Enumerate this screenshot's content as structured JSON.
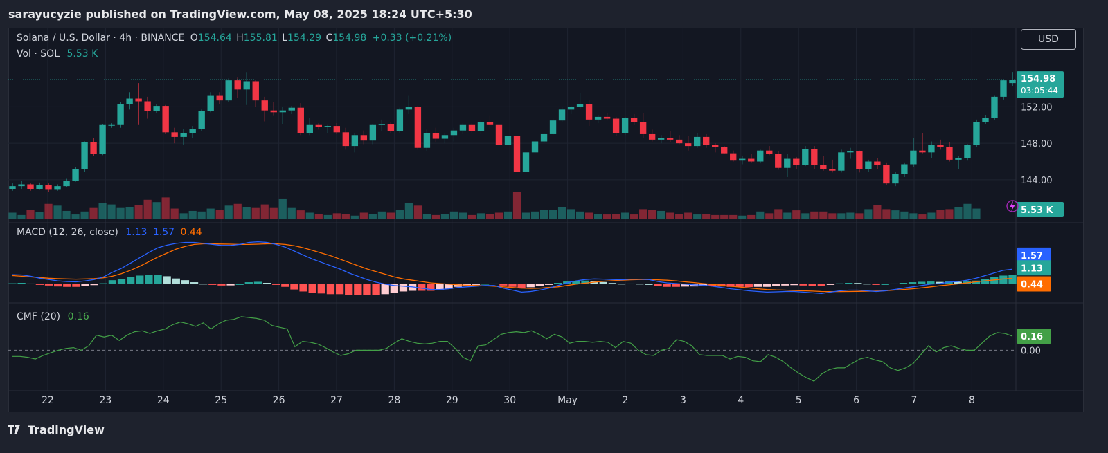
{
  "header": {
    "publisher": "sarayucyzie published on TradingView.com, May 08, 2025 18:24 UTC+5:30"
  },
  "legend": {
    "symbol": "Solana / U.S. Dollar · 4h · BINANCE",
    "o_label": "O",
    "o": "154.64",
    "h_label": "H",
    "h": "155.81",
    "l_label": "L",
    "l": "154.29",
    "c_label": "C",
    "c": "154.98",
    "change": "+0.33 (+0.21%)",
    "vol_label": "Vol · SOL",
    "vol": "5.53 K",
    "macd_label": "MACD (12, 26, close)",
    "macd": "1.13",
    "signal": "1.57",
    "hist": "0.44",
    "cmf_label": "CMF (20)",
    "cmf": "0.16"
  },
  "currency_button": "USD",
  "price_axis": {
    "ticks": [
      "152.00",
      "148.00",
      "144.00"
    ],
    "last_price": "154.98",
    "countdown": "03:05:44",
    "vol_badge": "5.53 K",
    "macd_badges": [
      "1.57",
      "1.13",
      "0.44"
    ],
    "cmf_badges": [
      "0.16",
      "0.00"
    ]
  },
  "colors": {
    "up": "#26a69a",
    "down": "#f23645",
    "macd": "#2962ff",
    "signal": "#ff6d00",
    "cmf": "#43a047",
    "hist_up_strong": "#26a69a",
    "hist_up_weak": "#b2dfdb",
    "hist_down_strong": "#ff5252",
    "hist_down_weak": "#ffcdd2"
  },
  "footer": {
    "brand": "TradingView"
  },
  "chart_data": {
    "type": "candlestick",
    "symbol": "SOLUSD",
    "interval": "4h",
    "exchange": "BINANCE",
    "x_tick_labels": [
      "22",
      "23",
      "24",
      "25",
      "26",
      "27",
      "28",
      "29",
      "30",
      "May",
      "2",
      "3",
      "4",
      "5",
      "6",
      "7",
      "8"
    ],
    "price_ylim": [
      140.2,
      158.4
    ],
    "ohlc": [
      [
        143.0,
        143.6,
        142.8,
        143.3
      ],
      [
        143.3,
        143.9,
        143.0,
        143.5
      ],
      [
        143.5,
        143.6,
        142.8,
        143.0
      ],
      [
        143.0,
        143.7,
        142.9,
        143.4
      ],
      [
        143.4,
        143.6,
        142.7,
        142.9
      ],
      [
        142.9,
        143.5,
        142.8,
        143.3
      ],
      [
        143.3,
        144.1,
        143.2,
        143.9
      ],
      [
        143.9,
        145.4,
        143.8,
        145.2
      ],
      [
        145.2,
        148.2,
        144.9,
        148.1
      ],
      [
        148.1,
        148.6,
        146.6,
        146.8
      ],
      [
        146.8,
        150.1,
        146.7,
        150.0
      ],
      [
        150.0,
        150.2,
        149.7,
        150.0
      ],
      [
        150.0,
        152.5,
        149.7,
        152.3
      ],
      [
        152.3,
        153.6,
        151.7,
        152.9
      ],
      [
        152.9,
        154.6,
        150.0,
        152.6
      ],
      [
        152.6,
        153.1,
        150.7,
        151.5
      ],
      [
        151.5,
        152.3,
        151.3,
        152.1
      ],
      [
        152.1,
        152.2,
        149.0,
        149.2
      ],
      [
        149.2,
        149.7,
        148.0,
        148.7
      ],
      [
        148.7,
        149.6,
        147.8,
        149.1
      ],
      [
        149.1,
        149.9,
        148.6,
        149.6
      ],
      [
        149.6,
        151.7,
        149.3,
        151.5
      ],
      [
        151.5,
        153.6,
        151.4,
        153.2
      ],
      [
        153.2,
        153.6,
        152.3,
        152.7
      ],
      [
        152.7,
        155.1,
        152.5,
        154.9
      ],
      [
        154.9,
        155.2,
        153.0,
        153.9
      ],
      [
        153.9,
        155.8,
        152.2,
        154.8
      ],
      [
        154.8,
        154.9,
        152.0,
        152.7
      ],
      [
        152.7,
        153.1,
        150.4,
        151.6
      ],
      [
        151.6,
        152.5,
        151.0,
        151.4
      ],
      [
        151.4,
        152.0,
        150.1,
        151.6
      ],
      [
        151.6,
        152.1,
        151.2,
        151.9
      ],
      [
        151.9,
        152.4,
        148.9,
        149.1
      ],
      [
        149.1,
        150.8,
        148.9,
        150.0
      ],
      [
        150.0,
        150.2,
        149.5,
        149.8
      ],
      [
        149.8,
        150.0,
        149.1,
        149.9
      ],
      [
        149.9,
        150.2,
        149.0,
        149.2
      ],
      [
        149.2,
        149.7,
        147.3,
        147.7
      ],
      [
        147.7,
        149.1,
        147.0,
        148.9
      ],
      [
        148.9,
        149.4,
        147.9,
        148.3
      ],
      [
        148.3,
        150.1,
        147.9,
        150.0
      ],
      [
        150.0,
        150.6,
        149.3,
        150.1
      ],
      [
        150.1,
        150.3,
        149.1,
        149.3
      ],
      [
        149.3,
        151.9,
        149.1,
        151.7
      ],
      [
        151.7,
        153.2,
        151.2,
        152.0
      ],
      [
        152.0,
        152.1,
        147.3,
        147.5
      ],
      [
        147.5,
        149.5,
        147.1,
        149.1
      ],
      [
        149.1,
        149.7,
        148.1,
        148.5
      ],
      [
        148.5,
        149.1,
        148.0,
        148.9
      ],
      [
        148.9,
        149.7,
        148.2,
        149.4
      ],
      [
        149.4,
        150.2,
        149.0,
        150.0
      ],
      [
        150.0,
        150.2,
        149.1,
        149.3
      ],
      [
        149.3,
        150.5,
        149.0,
        150.3
      ],
      [
        150.3,
        151.0,
        149.6,
        150.0
      ],
      [
        150.0,
        150.2,
        147.6,
        147.8
      ],
      [
        147.8,
        149.0,
        147.4,
        148.8
      ],
      [
        148.8,
        148.9,
        144.0,
        144.9
      ],
      [
        144.9,
        147.1,
        144.8,
        147.0
      ],
      [
        147.0,
        148.3,
        146.9,
        148.2
      ],
      [
        148.2,
        149.1,
        148.0,
        149.0
      ],
      [
        149.0,
        150.7,
        148.9,
        150.5
      ],
      [
        150.5,
        152.0,
        150.3,
        151.7
      ],
      [
        151.7,
        152.1,
        151.2,
        152.0
      ],
      [
        152.0,
        153.5,
        151.8,
        152.3
      ],
      [
        152.3,
        152.7,
        149.9,
        150.6
      ],
      [
        150.6,
        151.1,
        150.2,
        150.9
      ],
      [
        150.9,
        151.3,
        150.5,
        150.7
      ],
      [
        150.7,
        150.9,
        148.8,
        149.1
      ],
      [
        149.1,
        150.9,
        148.9,
        150.8
      ],
      [
        150.8,
        151.2,
        150.0,
        150.3
      ],
      [
        150.3,
        151.3,
        148.6,
        149.0
      ],
      [
        149.0,
        149.5,
        148.2,
        148.4
      ],
      [
        148.4,
        148.9,
        148.0,
        148.6
      ],
      [
        148.6,
        149.3,
        148.1,
        148.4
      ],
      [
        148.4,
        148.9,
        147.9,
        148.0
      ],
      [
        148.0,
        148.8,
        147.2,
        147.7
      ],
      [
        147.7,
        149.1,
        147.5,
        148.7
      ],
      [
        148.7,
        149.0,
        147.5,
        147.8
      ],
      [
        147.8,
        148.0,
        147.0,
        147.6
      ],
      [
        147.6,
        147.7,
        146.8,
        146.9
      ],
      [
        146.9,
        147.2,
        146.0,
        146.1
      ],
      [
        146.1,
        146.6,
        145.7,
        146.3
      ],
      [
        146.3,
        146.8,
        145.9,
        146.0
      ],
      [
        146.0,
        147.3,
        145.8,
        147.2
      ],
      [
        147.2,
        147.7,
        146.7,
        146.8
      ],
      [
        146.8,
        147.1,
        145.1,
        145.3
      ],
      [
        145.3,
        146.8,
        144.3,
        146.3
      ],
      [
        146.3,
        146.5,
        145.2,
        145.6
      ],
      [
        145.6,
        147.7,
        145.5,
        147.4
      ],
      [
        147.4,
        147.7,
        145.2,
        145.6
      ],
      [
        145.6,
        146.6,
        145.0,
        145.2
      ],
      [
        145.2,
        146.2,
        144.8,
        145.0
      ],
      [
        145.0,
        147.3,
        144.8,
        147.0
      ],
      [
        147.0,
        147.5,
        146.3,
        147.1
      ],
      [
        147.1,
        147.2,
        144.8,
        145.2
      ],
      [
        145.2,
        146.2,
        144.9,
        146.0
      ],
      [
        146.0,
        146.4,
        145.2,
        145.6
      ],
      [
        145.6,
        145.9,
        143.4,
        143.6
      ],
      [
        143.6,
        144.9,
        143.3,
        144.6
      ],
      [
        144.6,
        145.9,
        144.3,
        145.7
      ],
      [
        145.7,
        148.6,
        145.4,
        147.2
      ],
      [
        147.2,
        149.1,
        146.9,
        147.0
      ],
      [
        147.0,
        148.2,
        146.4,
        147.8
      ],
      [
        147.8,
        148.4,
        147.3,
        147.6
      ],
      [
        147.6,
        148.1,
        146.0,
        146.2
      ],
      [
        146.2,
        146.6,
        145.2,
        146.4
      ],
      [
        146.4,
        147.9,
        146.1,
        147.8
      ],
      [
        147.8,
        150.6,
        147.6,
        150.3
      ],
      [
        150.3,
        151.1,
        150.1,
        150.8
      ],
      [
        150.8,
        153.2,
        150.6,
        153.1
      ],
      [
        153.1,
        155.0,
        152.8,
        154.9
      ],
      [
        154.6,
        155.81,
        154.29,
        154.98
      ]
    ],
    "volume_k": [
      1.0,
      0.6,
      1.5,
      1.1,
      2.5,
      2.2,
      1.3,
      0.7,
      1.2,
      1.8,
      2.6,
      2.4,
      1.8,
      2.0,
      2.3,
      3.2,
      2.8,
      3.6,
      1.7,
      0.9,
      1.3,
      1.2,
      1.7,
      1.5,
      2.2,
      2.5,
      2.0,
      1.8,
      2.4,
      1.8,
      3.3,
      1.8,
      1.4,
      1.0,
      0.8,
      0.6,
      0.9,
      0.8,
      0.5,
      1.0,
      0.8,
      1.2,
      1.0,
      1.5,
      2.7,
      2.2,
      0.8,
      0.6,
      0.8,
      1.2,
      1.0,
      0.6,
      0.9,
      0.8,
      1.0,
      1.2,
      4.5,
      1.0,
      1.2,
      1.5,
      1.5,
      1.9,
      1.6,
      1.2,
      1.0,
      0.8,
      0.7,
      0.8,
      1.0,
      0.7,
      1.6,
      1.5,
      1.3,
      1.0,
      0.8,
      1.0,
      0.7,
      0.8,
      0.6,
      0.6,
      0.6,
      0.5,
      0.6,
      1.2,
      0.9,
      1.6,
      1.0,
      1.4,
      0.9,
      1.2,
      1.2,
      0.9,
      0.9,
      1.0,
      0.9,
      1.6,
      2.3,
      1.6,
      1.4,
      1.2,
      0.9,
      0.7,
      1.0,
      1.5,
      1.6,
      2.0,
      2.5,
      1.7
    ],
    "macd": [
      0.72,
      0.7,
      0.6,
      0.45,
      0.35,
      0.25,
      0.2,
      0.18,
      0.25,
      0.35,
      0.55,
      0.9,
      1.2,
      1.6,
      2.0,
      2.4,
      2.75,
      2.95,
      3.08,
      3.15,
      3.15,
      3.08,
      3.0,
      2.93,
      2.93,
      3.0,
      3.15,
      3.2,
      3.15,
      3.0,
      2.8,
      2.5,
      2.2,
      1.9,
      1.65,
      1.4,
      1.15,
      0.85,
      0.6,
      0.35,
      0.15,
      0.0,
      -0.1,
      -0.15,
      -0.2,
      -0.3,
      -0.4,
      -0.4,
      -0.35,
      -0.25,
      -0.2,
      -0.15,
      -0.1,
      -0.1,
      -0.3,
      -0.45,
      -0.6,
      -0.55,
      -0.45,
      -0.3,
      -0.1,
      0.1,
      0.25,
      0.35,
      0.4,
      0.38,
      0.35,
      0.33,
      0.38,
      0.38,
      0.35,
      0.2,
      0.1,
      0.05,
      0.0,
      -0.05,
      -0.08,
      -0.15,
      -0.25,
      -0.35,
      -0.42,
      -0.5,
      -0.55,
      -0.6,
      -0.58,
      -0.55,
      -0.55,
      -0.6,
      -0.65,
      -0.7,
      -0.6,
      -0.5,
      -0.45,
      -0.45,
      -0.5,
      -0.55,
      -0.5,
      -0.4,
      -0.3,
      -0.2,
      -0.1,
      0.0,
      0.05,
      0.15,
      0.2,
      0.3,
      0.45,
      0.65,
      0.85,
      1.05,
      1.13
    ],
    "signal": [
      0.65,
      0.6,
      0.55,
      0.5,
      0.45,
      0.42,
      0.4,
      0.38,
      0.4,
      0.42,
      0.48,
      0.6,
      0.8,
      1.05,
      1.35,
      1.7,
      2.05,
      2.35,
      2.65,
      2.85,
      3.0,
      3.05,
      3.05,
      3.03,
      3.02,
      3.0,
      3.0,
      3.02,
      3.05,
      3.05,
      3.0,
      2.9,
      2.75,
      2.55,
      2.35,
      2.15,
      1.9,
      1.65,
      1.4,
      1.15,
      0.95,
      0.75,
      0.55,
      0.4,
      0.3,
      0.2,
      0.1,
      0.05,
      0.0,
      -0.05,
      -0.08,
      -0.1,
      -0.12,
      -0.15,
      -0.2,
      -0.25,
      -0.3,
      -0.32,
      -0.3,
      -0.25,
      -0.2,
      -0.1,
      0.0,
      0.08,
      0.15,
      0.22,
      0.26,
      0.3,
      0.33,
      0.35,
      0.35,
      0.33,
      0.3,
      0.25,
      0.18,
      0.12,
      0.05,
      -0.02,
      -0.08,
      -0.15,
      -0.22,
      -0.28,
      -0.35,
      -0.4,
      -0.43,
      -0.45,
      -0.48,
      -0.5,
      -0.52,
      -0.55,
      -0.56,
      -0.56,
      -0.55,
      -0.54,
      -0.53,
      -0.52,
      -0.5,
      -0.45,
      -0.4,
      -0.35,
      -0.28,
      -0.2,
      -0.12,
      -0.05,
      0.02,
      0.1,
      0.18,
      0.25,
      0.32,
      0.4,
      0.44
    ],
    "macd_ylim": [
      -1.1,
      3.7
    ],
    "cmf": [
      -0.07,
      -0.07,
      -0.08,
      -0.1,
      -0.06,
      -0.03,
      0.0,
      0.02,
      0.03,
      0.0,
      0.05,
      0.17,
      0.15,
      0.17,
      0.11,
      0.17,
      0.21,
      0.22,
      0.19,
      0.22,
      0.24,
      0.29,
      0.32,
      0.3,
      0.27,
      0.31,
      0.24,
      0.3,
      0.34,
      0.35,
      0.38,
      0.37,
      0.36,
      0.34,
      0.28,
      0.26,
      0.24,
      0.04,
      0.1,
      0.09,
      0.07,
      0.03,
      -0.02,
      -0.06,
      -0.04,
      0.0,
      0.0,
      0.0,
      0.0,
      0.02,
      0.08,
      0.13,
      0.1,
      0.08,
      0.07,
      0.08,
      0.1,
      0.1,
      0.02,
      -0.08,
      -0.12,
      0.05,
      0.06,
      0.12,
      0.18,
      0.2,
      0.21,
      0.2,
      0.22,
      0.18,
      0.13,
      0.18,
      0.15,
      0.08,
      0.1,
      0.1,
      0.09,
      0.1,
      0.09,
      0.03,
      0.1,
      0.08,
      0.0,
      -0.05,
      -0.06,
      0.0,
      0.02,
      0.12,
      0.1,
      0.05,
      -0.05,
      -0.06,
      -0.06,
      -0.06,
      -0.1,
      -0.07,
      -0.08,
      -0.12,
      -0.13,
      -0.05,
      -0.08,
      -0.13,
      -0.2,
      -0.26,
      -0.31,
      -0.35,
      -0.27,
      -0.22,
      -0.2,
      -0.2,
      -0.15,
      -0.1,
      -0.08,
      -0.11,
      -0.13,
      -0.2,
      -0.23,
      -0.2,
      -0.15,
      -0.05,
      0.05,
      -0.02,
      0.03,
      0.05,
      0.02,
      0.0,
      0.0,
      0.08,
      0.16,
      0.2,
      0.19,
      0.16
    ],
    "cmf_ylim": [
      -0.42,
      0.52
    ]
  }
}
